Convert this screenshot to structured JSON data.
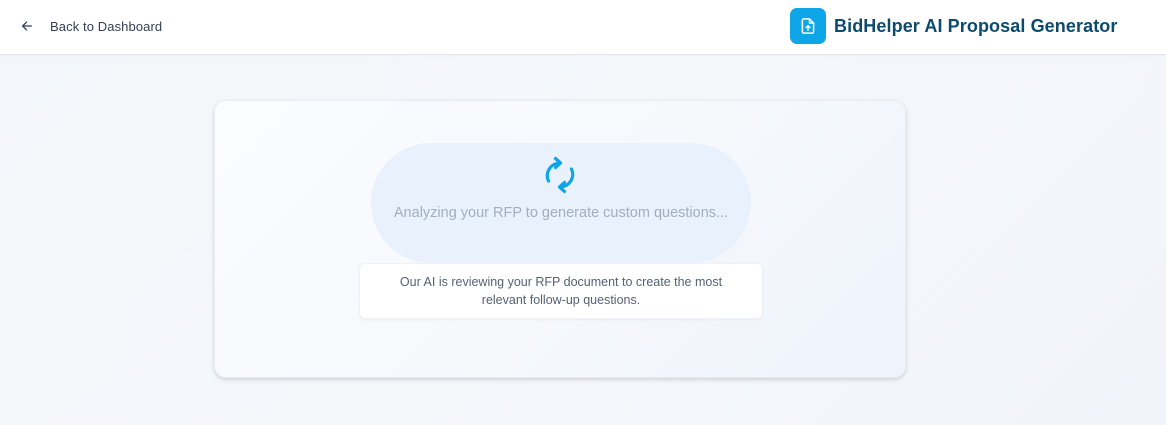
{
  "header": {
    "back_label": "Back to Dashboard",
    "back_icon": "arrow-left-icon",
    "brand_title": "BidHelper AI Proposal Generator",
    "brand_icon": "file-upload-icon",
    "brand_color": "#0ea5e9",
    "brand_text_color": "#0c4a6e"
  },
  "main": {
    "spinner_icon": "refresh-icon",
    "loading_message": "Analyzing your RFP to generate custom questions...",
    "info_message": "Our AI is reviewing your RFP document to create the most relevant follow-up questions.",
    "accent_color": "#0ea5e9"
  }
}
